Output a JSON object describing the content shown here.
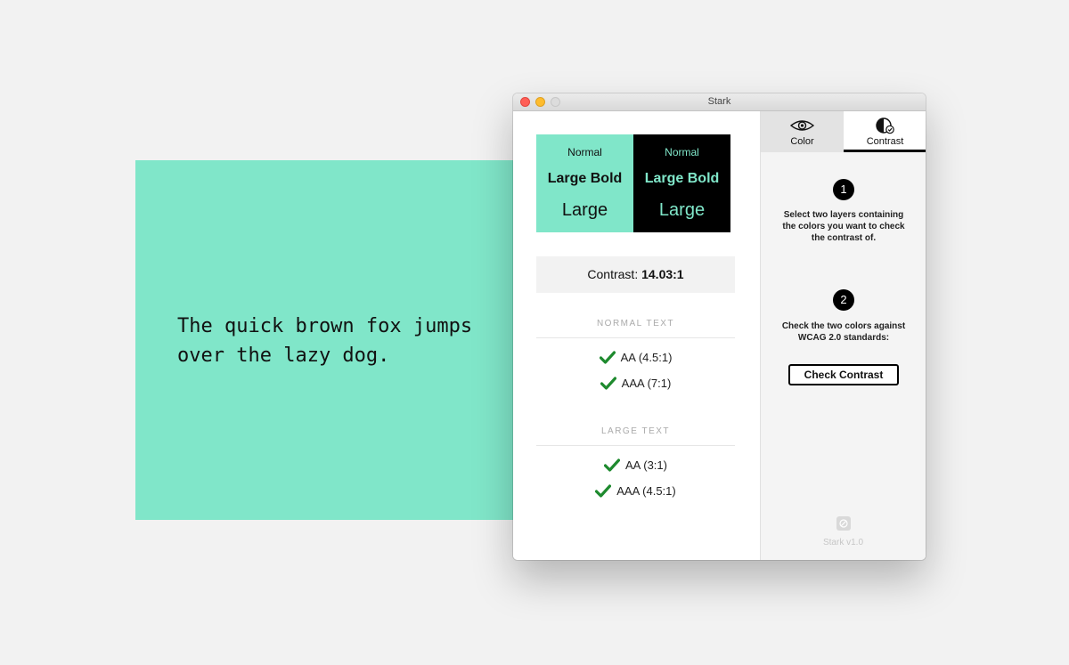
{
  "sample": {
    "text": "The quick brown fox jumps\nover the lazy dog."
  },
  "window": {
    "title": "Stark"
  },
  "preview": {
    "normal": "Normal",
    "large_bold": "Large Bold",
    "large": "Large"
  },
  "contrast": {
    "label": "Contrast:",
    "ratio": "14.03:1"
  },
  "normal_text": {
    "heading": "NORMAL TEXT",
    "checks": [
      {
        "label": "AA (4.5:1)",
        "passed": true
      },
      {
        "label": "AAA (7:1)",
        "passed": true
      }
    ]
  },
  "large_text": {
    "heading": "LARGE TEXT",
    "checks": [
      {
        "label": "AA (3:1)",
        "passed": true
      },
      {
        "label": "AAA (4.5:1)",
        "passed": true
      }
    ]
  },
  "tabs": [
    {
      "label": "Color",
      "icon": "eye-icon",
      "active": false
    },
    {
      "label": "Contrast",
      "icon": "contrast-icon",
      "active": true
    }
  ],
  "steps": [
    {
      "number": "1",
      "text": "Select two layers containing the colors you want to check the contrast of."
    },
    {
      "number": "2",
      "text": "Check the two colors against WCAG 2.0 standards:"
    }
  ],
  "check_button": {
    "label": "Check Contrast"
  },
  "footer": {
    "version": "Stark v1.0"
  },
  "colors": {
    "foreground": "#80e6c9",
    "background": "#000000",
    "pass_check": "#1e8a2e"
  }
}
